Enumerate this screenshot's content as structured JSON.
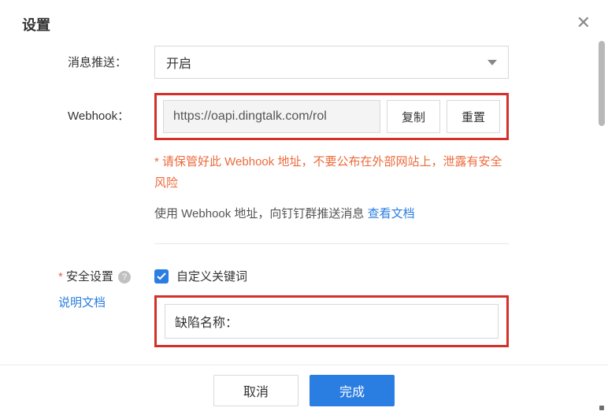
{
  "header": {
    "title": "设置"
  },
  "push": {
    "label": "消息推送：",
    "value": "开启"
  },
  "webhook": {
    "label": "Webhook：",
    "url": "https://oapi.dingtalk.com/rol",
    "copy_label": "复制",
    "reset_label": "重置",
    "warning": "* 请保管好此 Webhook 地址，不要公布在外部网站上，泄露有安全风险",
    "help_prefix": "使用 Webhook 地址，向钉钉群推送消息 ",
    "doc_link": "查看文档"
  },
  "security": {
    "label": "安全设置",
    "spec_doc": "说明文档",
    "keyword_check_label": "自定义关键词",
    "keyword_value": "缺陷名称："
  },
  "footer": {
    "cancel": "取消",
    "confirm": "完成"
  },
  "icons": {
    "close": "✕",
    "help": "?"
  }
}
